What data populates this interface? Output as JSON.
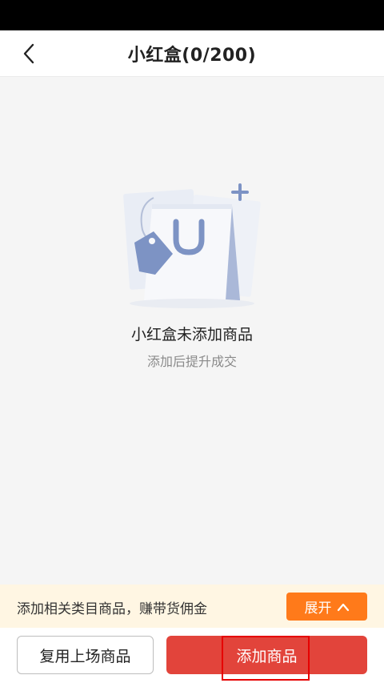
{
  "header": {
    "title": "小红盒(0/200)",
    "back_icon": "chevron-left-icon"
  },
  "empty_state": {
    "illustration_icon": "shopping-bag-icon",
    "title": "小红盒未添加商品",
    "subtitle": "添加后提升成交"
  },
  "promo": {
    "text": "添加相关类目商品，赚带货佣金",
    "expand_label": "展开",
    "expand_icon": "chevron-up-icon"
  },
  "actions": {
    "reuse_label": "复用上场商品",
    "add_label": "添加商品"
  },
  "colors": {
    "accent_red": "#e2443b",
    "accent_orange": "#ff7a1a",
    "promo_bg": "#fff6e3",
    "illustration_blue": "#7d93c4"
  }
}
